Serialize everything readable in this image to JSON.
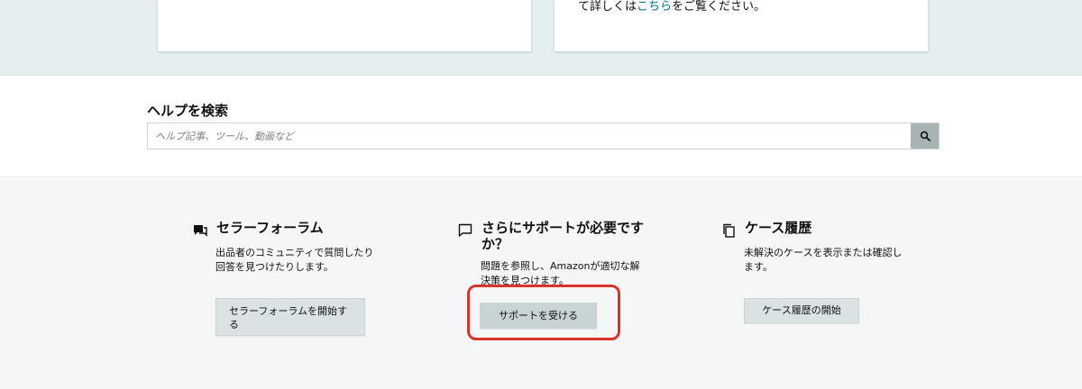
{
  "top": {
    "right_card": {
      "text_before": "て詳しくは",
      "link": "こちら",
      "text_after": "をご覧ください。"
    }
  },
  "search": {
    "title": "ヘルプを検索",
    "placeholder": "ヘルプ記事、ツール、動画など",
    "button_icon": "search-icon"
  },
  "help_columns": [
    {
      "icon": "forum-chat-icon",
      "title": "セラーフォーラム",
      "description": "出品者のコミュニティで質問したり回答を見つけたりします。",
      "button": "セラーフォーラムを開始する"
    },
    {
      "icon": "speech-bubble-icon",
      "title": "さらにサポートが必要ですか？",
      "description": "問題を参照し、Amazonが適切な解決策を見つけます。",
      "button": "サポートを受ける"
    },
    {
      "icon": "copy-documents-icon",
      "title": "ケース履歴",
      "description": "未解決のケースを表示または確認します。",
      "button": "ケース履歴の開始"
    }
  ],
  "colors": {
    "top_band": "#e5eff0",
    "link": "#007185",
    "highlight": "#d9342b",
    "button_bg": "#dbe2e3"
  }
}
